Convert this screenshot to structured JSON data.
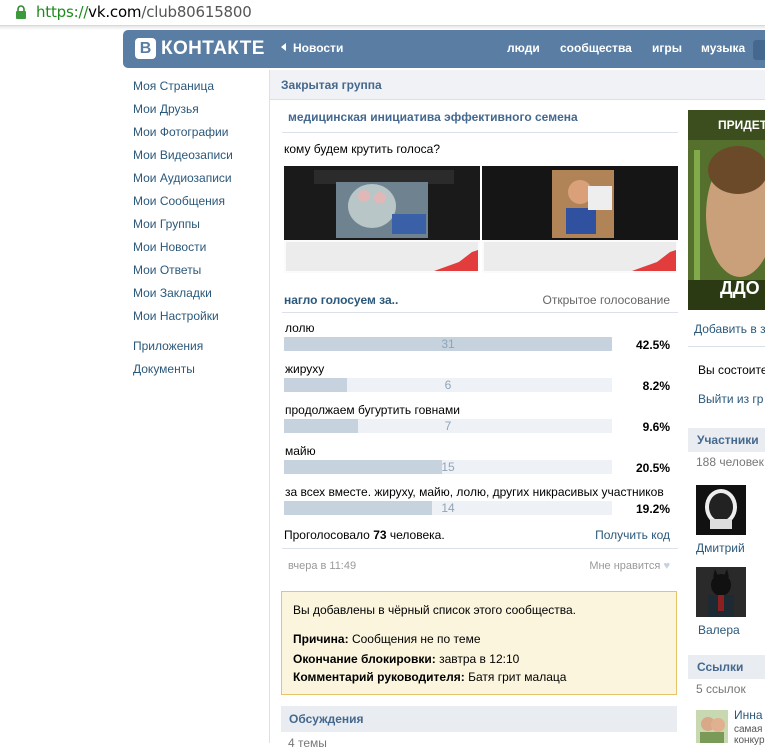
{
  "browser": {
    "url_scheme": "https://",
    "url_host": "vk.com",
    "url_path": "/club80615800"
  },
  "header": {
    "logo_letter": "B",
    "logo_text": "КОНТАКТЕ",
    "news": "Новости",
    "nav": [
      "люди",
      "сообщества",
      "игры",
      "музыка"
    ]
  },
  "sidebar": {
    "items": [
      "Моя Страница",
      "Мои Друзья",
      "Мои Фотографии",
      "Мои Видеозаписи",
      "Мои Аудиозаписи",
      "Мои Сообщения",
      "Мои Группы",
      "Мои Новости",
      "Мои Ответы",
      "Мои Закладки",
      "Мои Настройки"
    ],
    "extra": [
      "Приложения",
      "Документы"
    ]
  },
  "group": {
    "status": "Закрытая группа",
    "title": "медицинская инициатива эффективного семена",
    "post_text": "кому будем крутить голоса?"
  },
  "poll": {
    "title": "нагло голосуем за..",
    "type": "Открытое голосование",
    "options": [
      {
        "label": "лолю",
        "count": "31",
        "percent": "42.5%",
        "fraction": 0.425
      },
      {
        "label": "жируху",
        "count": "6",
        "percent": "8.2%",
        "fraction": 0.082
      },
      {
        "label": "продолжаем бугуртить говнами",
        "count": "7",
        "percent": "9.6%",
        "fraction": 0.096
      },
      {
        "label": "майю",
        "count": "15",
        "percent": "20.5%",
        "fraction": 0.205
      },
      {
        "label": "за всех вместе. жируху, майю, лолю, других никрасивых участников",
        "count": "14",
        "percent": "19.2%",
        "fraction": 0.192
      }
    ],
    "voted_prefix": "Проголосовало",
    "voted_count": "73",
    "voted_suffix": "человека.",
    "get_code": "Получить код"
  },
  "post_meta": {
    "date": "вчера в 11:49",
    "like": "Мне нравится"
  },
  "ban": {
    "message": "Вы добавлены в чёрный список этого сообщества.",
    "reason_label": "Причина:",
    "reason": "Сообщения не по теме",
    "end_label": "Окончание блокировки:",
    "end": "завтра в 12:10",
    "comment_label": "Комментарий руководителя:",
    "comment": "Батя грит малаца"
  },
  "discussions": {
    "title": "Обсуждения",
    "subtitle": "4 темы"
  },
  "right": {
    "avatar_text": "ПРИДЕТ",
    "avatar_bottom": "ДДО",
    "add_link": "Добавить в з",
    "member_status": "Вы состоите",
    "leave_link": "Выйти из гр",
    "members_title": "Участники",
    "members_count": "188 человек",
    "member1": "Дмитрий",
    "member2": "Валера",
    "links_title": "Ссылки",
    "links_count": "5 ссылок",
    "link1": "Инна",
    "link1_sub1": "самая",
    "link1_sub2": "конкур"
  }
}
